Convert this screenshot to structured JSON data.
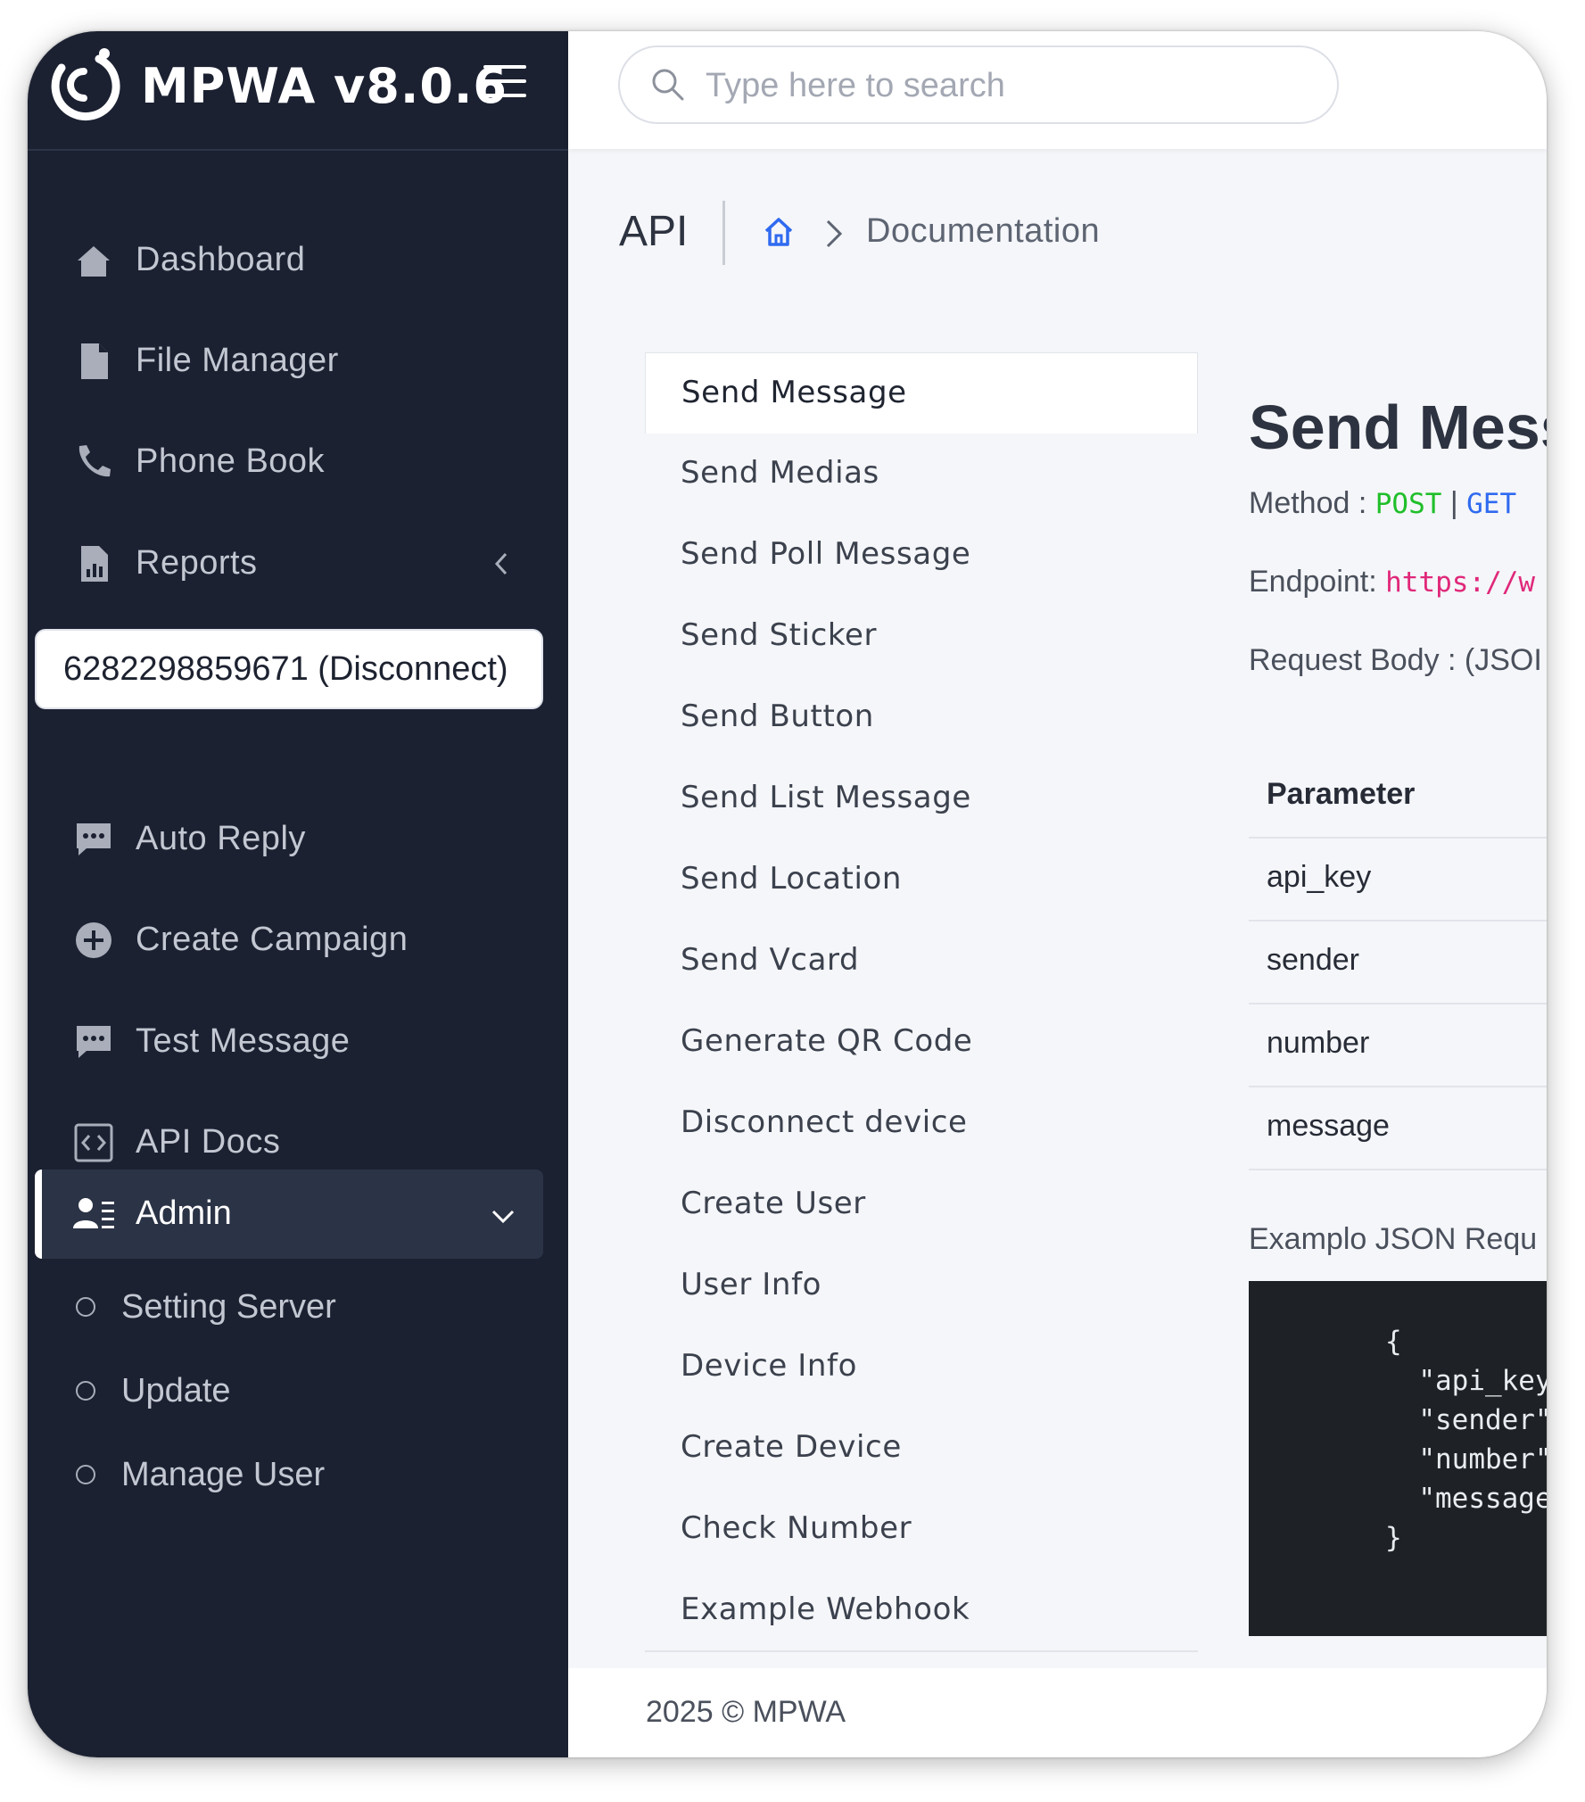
{
  "app": {
    "title": "MPWA v8.0.6"
  },
  "search": {
    "placeholder": "Type here to search"
  },
  "sidebar": {
    "items": [
      {
        "label": "Dashboard",
        "icon": "home-icon"
      },
      {
        "label": "File Manager",
        "icon": "file-icon"
      },
      {
        "label": "Phone Book",
        "icon": "phone-icon"
      },
      {
        "label": "Reports",
        "icon": "report-icon"
      }
    ],
    "device": "6282298859671 (Disconnect)",
    "items2": [
      {
        "label": "Auto Reply",
        "icon": "chat-icon"
      },
      {
        "label": "Create Campaign",
        "icon": "plus-circle-icon"
      },
      {
        "label": "Test Message",
        "icon": "chat-icon"
      },
      {
        "label": "API Docs",
        "icon": "code-icon"
      }
    ],
    "admin": {
      "label": "Admin",
      "icon": "user-list-icon"
    },
    "sub_items": [
      {
        "label": "Setting Server"
      },
      {
        "label": "Update"
      },
      {
        "label": "Manage User"
      }
    ]
  },
  "header": {
    "title": "API",
    "breadcrumb_current": "Documentation"
  },
  "api_menu": [
    "Send Message",
    "Send Medias",
    "Send Poll Message",
    "Send Sticker",
    "Send Button",
    "Send List Message",
    "Send Location",
    "Send Vcard",
    "Generate QR Code",
    "Disconnect device",
    "Create User",
    "User Info",
    "Device Info",
    "Create Device",
    "Check Number",
    "Example Webhook"
  ],
  "content": {
    "title": "Send Mess",
    "method_label": "Method : ",
    "method_post": "POST",
    "method_sep": " | ",
    "method_get": "GET",
    "endpoint_label": "Endpoint: ",
    "endpoint_value": "https://w",
    "request_body_label": "Request Body : (JSOI",
    "table_header": "Parameter",
    "params": [
      "api_key",
      "sender",
      "number",
      "message"
    ],
    "example_label": "Examplo JSON Requ",
    "code": "{\n  \"api_key\n  \"sender\"\n  \"number\"\n  \"message\n}"
  },
  "footer": {
    "text": "2025 © MPWA"
  },
  "colors": {
    "sidebar_bg": "#1b2131",
    "post": "#1fbf2a",
    "get": "#2f6af0",
    "endpoint": "#e0287a",
    "home_icon": "#2f6af0"
  }
}
